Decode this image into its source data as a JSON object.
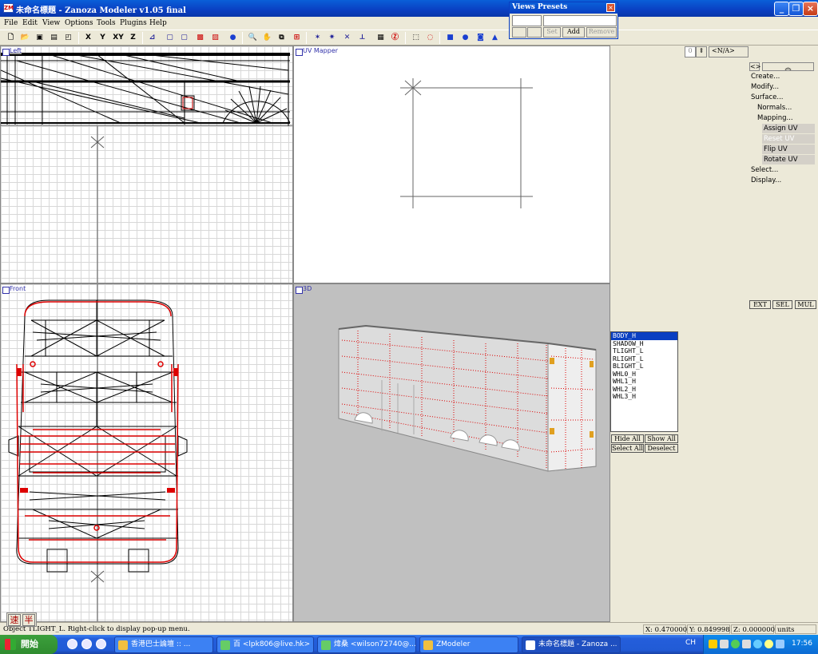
{
  "window": {
    "title": "未命名標題 - Zanoza Modeler v1.05 final",
    "icon_text": "ZM"
  },
  "menu": [
    "File",
    "Edit",
    "View",
    "Options",
    "Tools",
    "Plugins",
    "Help"
  ],
  "toolbar": {
    "axis_x": "X",
    "axis_y": "Y",
    "axis_xy": "XY",
    "axis_z": "Z"
  },
  "views_presets": {
    "title": "Views Presets",
    "set_label": "Set",
    "add_label": "Add",
    "remove_label": "Remove"
  },
  "viewports": {
    "left": "Left",
    "uv": "UV Mapper",
    "front": "Front",
    "three_d": "3D"
  },
  "panel": {
    "spin_value": "0",
    "na_label": "<N/A>",
    "lr_label": "<>",
    "menu": [
      {
        "label": "Create...",
        "level": 0,
        "selected": false
      },
      {
        "label": "Modify...",
        "level": 0,
        "selected": false
      },
      {
        "label": "Surface...",
        "level": 0,
        "selected": false
      },
      {
        "label": "Normals...",
        "level": 1,
        "selected": false
      },
      {
        "label": "Mapping...",
        "level": 1,
        "selected": false
      },
      {
        "label": "Assign UV",
        "level": 2,
        "selected": false
      },
      {
        "label": "Reset UV",
        "level": 2,
        "selected": true
      },
      {
        "label": "Flip UV",
        "level": 2,
        "selected": false
      },
      {
        "label": "Rotate UV",
        "level": 2,
        "selected": false
      },
      {
        "label": "Select...",
        "level": 0,
        "selected": false
      },
      {
        "label": "Display...",
        "level": 0,
        "selected": false
      }
    ],
    "sel_modes": [
      "EXT",
      "SEL",
      "MUL"
    ],
    "objects": [
      "BODY_H",
      "SHADOW_H",
      "TLIGHT_L",
      "RLIGHT_L",
      "BLIGHT_L",
      "WHL0_H",
      "WHL1_H",
      "WHL2_H",
      "WHL3_H"
    ],
    "selected_object": "BODY_H",
    "hide_all": "Hide All",
    "show_all": "Show All",
    "select_all": "Select All",
    "deselect": "Deselect"
  },
  "status": {
    "message": "Object TLIGHT_L. Right-click to display pop-up menu.",
    "x": "X: 0.470000",
    "y": "Y: 0.849998",
    "z": "Z: 0.000000",
    "units": "units"
  },
  "ime": {
    "a": "速",
    "b": "半"
  },
  "taskbar": {
    "start": "開始",
    "tasks": [
      "香港巴士論壇 :: ...",
      "百 <lpk806@live.hk>",
      "煒桑 <wilson72740@...",
      "ZModeler",
      "未命名標題 - Zanoza ..."
    ],
    "lang": "CH",
    "clock": "17:56"
  },
  "colors": {
    "wire": "#000000",
    "selection": "#e00000",
    "viewport_bg": "#ffffff",
    "grid": "#d8d8d8",
    "shaded_bg": "#c0c0c0"
  }
}
